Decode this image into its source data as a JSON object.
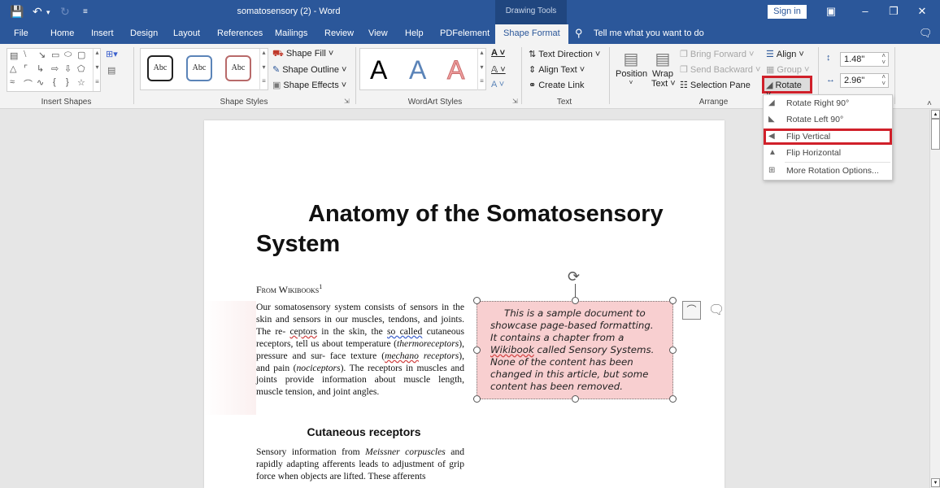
{
  "window": {
    "doc_title": "somatosensory (2)  -  Word",
    "context_label": "Drawing Tools",
    "sign_in": "Sign in",
    "icons": [
      "save-icon",
      "undo-icon",
      "redo-icon",
      "customize-qat-icon",
      "ribbon-display-icon",
      "minimize-icon",
      "restore-icon",
      "close-icon"
    ]
  },
  "tabs": [
    {
      "label": "File"
    },
    {
      "label": "Home"
    },
    {
      "label": "Insert"
    },
    {
      "label": "Design"
    },
    {
      "label": "Layout"
    },
    {
      "label": "References"
    },
    {
      "label": "Mailings"
    },
    {
      "label": "Review"
    },
    {
      "label": "View"
    },
    {
      "label": "Help"
    },
    {
      "label": "PDFelement"
    },
    {
      "label": "Shape Format",
      "active": true
    }
  ],
  "tell_me": "Tell me what you want to do",
  "ribbon": {
    "insert_shapes": {
      "label": "Insert Shapes"
    },
    "shape_styles": {
      "label": "Shape Styles",
      "preview_text": "Abc",
      "fill": "Shape Fill",
      "outline": "Shape Outline",
      "effects": "Shape Effects"
    },
    "wordart": {
      "label": "WordArt Styles",
      "letter": "A"
    },
    "text": {
      "label": "Text",
      "direction": "Text Direction",
      "align": "Align Text",
      "link": "Create Link"
    },
    "arrange": {
      "label": "Arrange",
      "position": "Position",
      "wrap_line1": "Wrap",
      "wrap_line2": "Text",
      "bring_forward": "Bring Forward",
      "send_backward": "Send Backward",
      "selection_pane": "Selection Pane",
      "align": "Align",
      "group": "Group",
      "rotate": "Rotate"
    },
    "size": {
      "height": "1.48\"",
      "width": "2.96\""
    }
  },
  "rotate_menu": [
    {
      "label": "Rotate Right 90°",
      "icon": "rotate-right-icon"
    },
    {
      "label": "Rotate Left 90°",
      "icon": "rotate-left-icon"
    },
    {
      "label": "Flip Vertical",
      "icon": "flip-vertical-icon",
      "highlighted": true
    },
    {
      "label": "Flip Horizontal",
      "icon": "flip-horizontal-icon"
    },
    {
      "label": "More Rotation Options...",
      "icon": "more-rotation-icon"
    }
  ],
  "document": {
    "title": "Anatomy of the Somatosensory System",
    "from": "From Wikibooks",
    "footnote": "1",
    "para1_a": "Our somatosensory system consists of sensors in the skin and sensors in our muscles, tendons, and joints. The re- ",
    "para1_ceptors": "ceptors",
    "para1_b": " in the skin, the ",
    "para1_socalled": "so called",
    "para1_c": " cutaneous receptors, tell us about temperature (",
    "para1_thermo": "thermoreceptors",
    "para1_d": "), pressure and sur- face texture (",
    "para1_mechano": "mechano",
    "para1_receptors": " receptors",
    "para1_e": "), and pain (",
    "para1_noci": "nociceptors",
    "para1_f": "). The receptors in muscles and joints provide information about muscle length, muscle tension, and joint angles.",
    "heading2": "Cutaneous receptors",
    "para2_a": "Sensory information from ",
    "para2_meissner": "Meissner corpuscles",
    "para2_b": " and rapidly adapting afferents leads to adjustment of grip force when objects are lifted. These afferents",
    "textbox_a": "This is a sample document to showcase page-based formatting. It contains a chapter from a ",
    "textbox_wiki": "Wikibook",
    "textbox_b": " called Sensory Systems. None of the content has been changed in this article, but some content has been removed."
  },
  "colors": {
    "brand": "#2b579a",
    "highlight": "#d0202a",
    "textbox_fill": "#f8cfd0"
  }
}
